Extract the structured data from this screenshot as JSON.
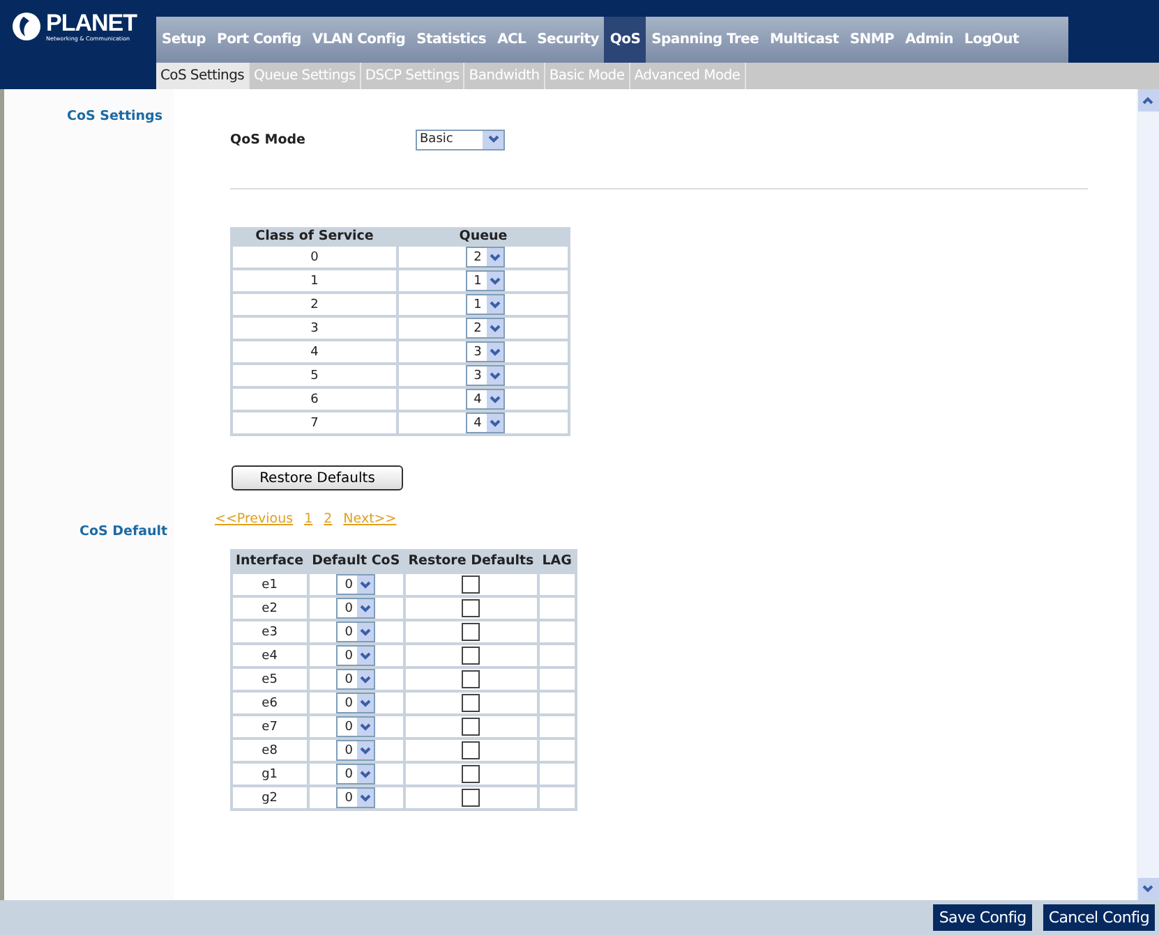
{
  "logo": {
    "name": "PLANET",
    "tagline": "Networking & Communication"
  },
  "main_tabs": [
    {
      "label": "Setup",
      "selected": false
    },
    {
      "label": "Port Config",
      "selected": false
    },
    {
      "label": "VLAN Config",
      "selected": false
    },
    {
      "label": "Statistics",
      "selected": false
    },
    {
      "label": "ACL",
      "selected": false
    },
    {
      "label": "Security",
      "selected": false
    },
    {
      "label": "QoS",
      "selected": true
    },
    {
      "label": "Spanning Tree",
      "selected": false
    },
    {
      "label": "Multicast",
      "selected": false
    },
    {
      "label": "SNMP",
      "selected": false
    },
    {
      "label": "Admin",
      "selected": false
    },
    {
      "label": "LogOut",
      "selected": false
    }
  ],
  "sub_tabs": [
    {
      "label": "CoS Settings",
      "selected": true
    },
    {
      "label": "Queue Settings",
      "selected": false
    },
    {
      "label": "DSCP Settings",
      "selected": false
    },
    {
      "label": "Bandwidth",
      "selected": false
    },
    {
      "label": "Basic Mode",
      "selected": false
    },
    {
      "label": "Advanced Mode",
      "selected": false
    }
  ],
  "cos_settings": {
    "heading": "CoS Settings",
    "mode_label": "QoS Mode",
    "mode_value": "Basic",
    "columns": [
      "Class of Service",
      "Queue"
    ],
    "rows": [
      {
        "cos": "0",
        "queue": "2"
      },
      {
        "cos": "1",
        "queue": "1"
      },
      {
        "cos": "2",
        "queue": "1"
      },
      {
        "cos": "3",
        "queue": "2"
      },
      {
        "cos": "4",
        "queue": "3"
      },
      {
        "cos": "5",
        "queue": "3"
      },
      {
        "cos": "6",
        "queue": "4"
      },
      {
        "cos": "7",
        "queue": "4"
      }
    ],
    "restore_button": "Restore Defaults"
  },
  "cos_default": {
    "heading": "CoS Default",
    "pagination": [
      "<<Previous",
      "1",
      "2",
      "Next>>"
    ],
    "columns": [
      "Interface",
      "Default CoS",
      "Restore Defaults",
      "LAG"
    ],
    "rows": [
      {
        "interface": "e1",
        "default_cos": "0",
        "restore": false
      },
      {
        "interface": "e2",
        "default_cos": "0",
        "restore": false
      },
      {
        "interface": "e3",
        "default_cos": "0",
        "restore": false
      },
      {
        "interface": "e4",
        "default_cos": "0",
        "restore": false
      },
      {
        "interface": "e5",
        "default_cos": "0",
        "restore": false
      },
      {
        "interface": "e6",
        "default_cos": "0",
        "restore": false
      },
      {
        "interface": "e7",
        "default_cos": "0",
        "restore": false
      },
      {
        "interface": "e8",
        "default_cos": "0",
        "restore": false
      },
      {
        "interface": "g1",
        "default_cos": "0",
        "restore": false
      },
      {
        "interface": "g2",
        "default_cos": "0",
        "restore": false
      }
    ]
  },
  "footer_buttons": [
    "Save Config",
    "Cancel Config"
  ]
}
